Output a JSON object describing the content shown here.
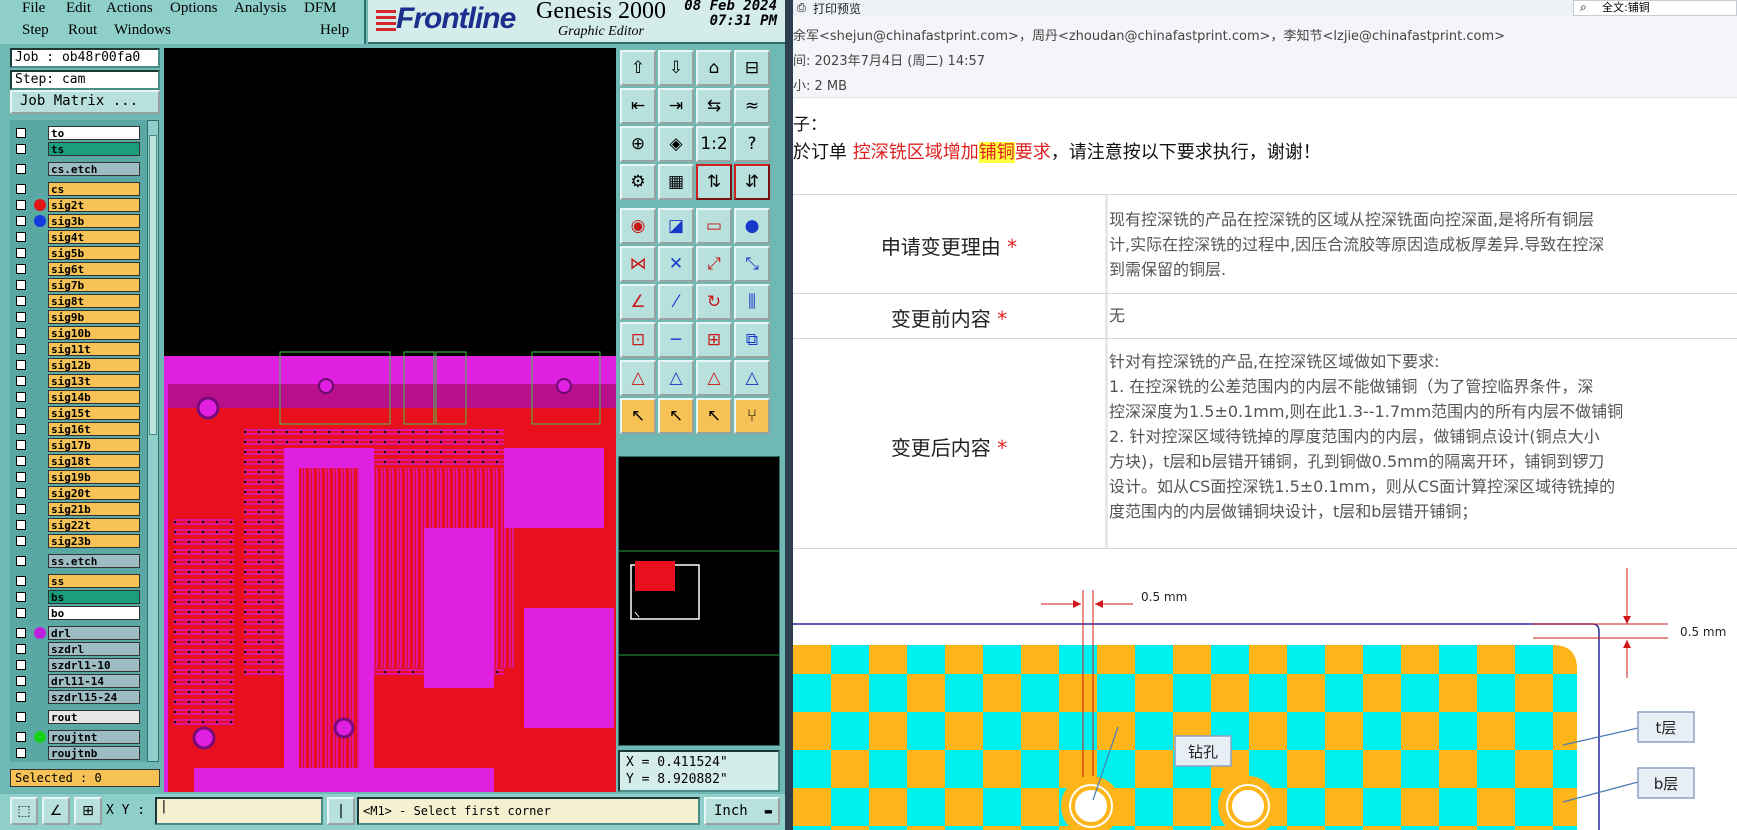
{
  "genesis": {
    "menus_row1": [
      "File",
      "Edit",
      "Actions",
      "Options",
      "Analysis",
      "DFM"
    ],
    "menus_row2": [
      "Step",
      "Rout",
      "Windows",
      "Help"
    ],
    "brand": {
      "logo": "Frontline",
      "product": "Genesis 2000",
      "subtitle": "Graphic Editor",
      "date": "08 Feb 2024",
      "time": "07:31 PM"
    },
    "job": "Job : ob48r00fa0",
    "step": "Step: cam",
    "job_matrix": "Job Matrix ...",
    "layers": [
      {
        "name": "to",
        "color": "#ffffff"
      },
      {
        "name": "ts",
        "color": "#1a9e7e"
      },
      {
        "name": "cs.etch",
        "color": "#9ebcc4"
      },
      {
        "name": "cs",
        "color": "#f6c255"
      },
      {
        "name": "sig2t",
        "color": "#f6c255",
        "dot": "#e01818"
      },
      {
        "name": "sig3b",
        "color": "#f6c255",
        "dot": "#1838e0"
      },
      {
        "name": "sig4t",
        "color": "#f6c255"
      },
      {
        "name": "sig5b",
        "color": "#f6c255"
      },
      {
        "name": "sig6t",
        "color": "#f6c255"
      },
      {
        "name": "sig7b",
        "color": "#f6c255"
      },
      {
        "name": "sig8t",
        "color": "#f6c255"
      },
      {
        "name": "sig9b",
        "color": "#f6c255"
      },
      {
        "name": "sig10b",
        "color": "#f6c255"
      },
      {
        "name": "sig11t",
        "color": "#f6c255"
      },
      {
        "name": "sig12b",
        "color": "#f6c255"
      },
      {
        "name": "sig13t",
        "color": "#f6c255"
      },
      {
        "name": "sig14b",
        "color": "#f6c255"
      },
      {
        "name": "sig15t",
        "color": "#f6c255"
      },
      {
        "name": "sig16t",
        "color": "#f6c255"
      },
      {
        "name": "sig17b",
        "color": "#f6c255"
      },
      {
        "name": "sig18t",
        "color": "#f6c255"
      },
      {
        "name": "sig19b",
        "color": "#f6c255"
      },
      {
        "name": "sig20t",
        "color": "#f6c255"
      },
      {
        "name": "sig21b",
        "color": "#f6c255"
      },
      {
        "name": "sig22t",
        "color": "#f6c255"
      },
      {
        "name": "sig23b",
        "color": "#f6c255"
      },
      {
        "name": "ss.etch",
        "color": "#9ebcc4"
      },
      {
        "name": "ss",
        "color": "#f6c255"
      },
      {
        "name": "bs",
        "color": "#1a9e7e"
      },
      {
        "name": "bo",
        "color": "#ffffff"
      },
      {
        "name": "drl",
        "color": "#9ebcc4",
        "dot": "#c020e0"
      },
      {
        "name": "szdrl",
        "color": "#9ebcc4"
      },
      {
        "name": "szdrl1-10",
        "color": "#9ebcc4"
      },
      {
        "name": "drl11-14",
        "color": "#9ebcc4"
      },
      {
        "name": "szdrl15-24",
        "color": "#9ebcc4"
      },
      {
        "name": "rout",
        "color": "#e6e6e6"
      },
      {
        "name": "roujtnt",
        "color": "#9ebcc4",
        "dot": "#18d018"
      },
      {
        "name": "roujtnb",
        "color": "#9ebcc4"
      }
    ],
    "selected": "Selected : 0",
    "coords": {
      "x": "X = 0.411524\"",
      "y": "Y = 8.920882\""
    },
    "xy_label": "X Y :",
    "prompt": "<M1> - Select first corner",
    "unit": "Inch",
    "tool_labels": {
      "ratio": "1:2",
      "help": "?"
    }
  },
  "mail": {
    "print_preview": "打印预览",
    "search": "全文:铺铜",
    "from": "余军<shejun@chinafastprint.com>，周丹<zhoudan@chinafastprint.com>，李知节<lzjie@chinafastprint.com>",
    "date": "间: 2023年7月4日 (周二) 14:57",
    "size": "小: 2 MB",
    "greeting": "子：",
    "body_prefix": "於订单 ",
    "body_red1": "控深铣区域增加",
    "body_hl": "铺铜",
    "body_red2": "要求",
    "body_suffix": "，请注意按以下要求执行，谢谢！",
    "rows": [
      {
        "label": "申请变更理由",
        "star": "*",
        "lines": [
          "现有控深铣的产品在控深铣的区域从控深铣面向控深面,是将所有铜层",
          "计,实际在控深铣的过程中,因压合流胶等原因造成板厚差异.导致在控深",
          "到需保留的铜层."
        ]
      },
      {
        "label": "变更前内容",
        "star": "*",
        "lines": [
          "无"
        ]
      },
      {
        "label": "变更后内容",
        "star": "*",
        "lines": [
          "针对有控深铣的产品,在控深铣区域做如下要求:",
          "1. 在控深铣的公差范围内的内层不能做铺铜（为了管控临界条件，深",
          "控深深度为1.5±0.1mm,则在此1.3--1.7mm范围内的所有内层不做铺铜",
          "2. 针对控深区域待铣掉的厚度范围内的内层，做铺铜点设计(铜点大小",
          "方块)，t层和b层错开铺铜，孔到铜做0.5mm的隔离开环，铺铜到锣刀",
          "设计。如从CS面控深铣1.5±0.1mm，则从CS面计算控深区域待铣掉的",
          "度范围内的内层做铺铜块设计，t层和b层错开铺铜；"
        ]
      }
    ],
    "diagram": {
      "dim1": "0.5 mm",
      "dim2": "0.5 mm",
      "drill": "钻孔",
      "t_layer": "t层",
      "b_layer": "b层"
    }
  },
  "colors": {
    "genesis_bg": "#6fb8b4",
    "board_red": "#e8101c",
    "board_magenta": "#e020e0",
    "checker_cyan": "#00f0f0",
    "checker_orange": "#fdb51a"
  }
}
